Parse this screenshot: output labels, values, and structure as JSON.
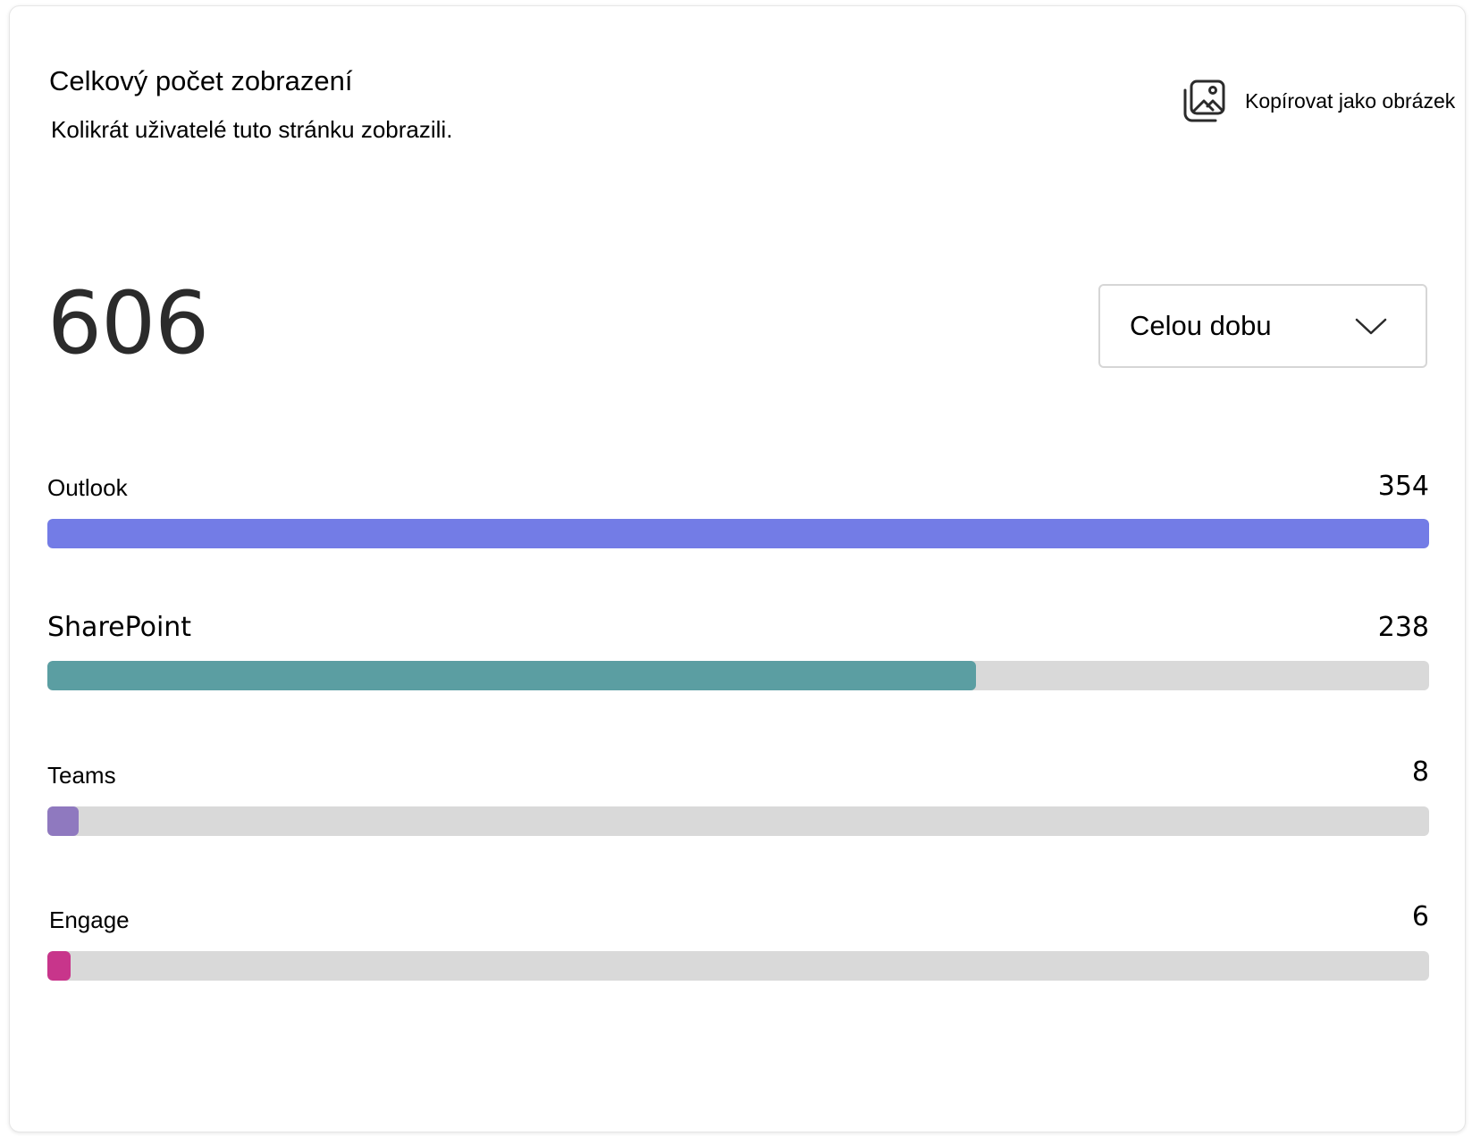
{
  "card": {
    "title": "Celkový počet zobrazení",
    "subtitle": "Kolikrát uživatelé tuto stránku zobrazili.",
    "copy_label": "Kopírovat jako obrázek",
    "copy_icon": "image-copy-icon",
    "total": "606",
    "dropdown": {
      "selected": "Celou dobu",
      "icon": "chevron-down-icon"
    }
  },
  "breakdown": [
    {
      "name": "Outlook",
      "count": "354",
      "value": 354,
      "color": "#737ce6"
    },
    {
      "name": "SharePoint",
      "count": "238",
      "value": 238,
      "color": "#5b9ea2"
    },
    {
      "name": "Teams",
      "count": "8",
      "value": 8,
      "color": "#8f79bf"
    },
    {
      "name": "Engage",
      "count": "6",
      "value": 6,
      "color": "#c8358b"
    }
  ],
  "scale_max": 354
}
